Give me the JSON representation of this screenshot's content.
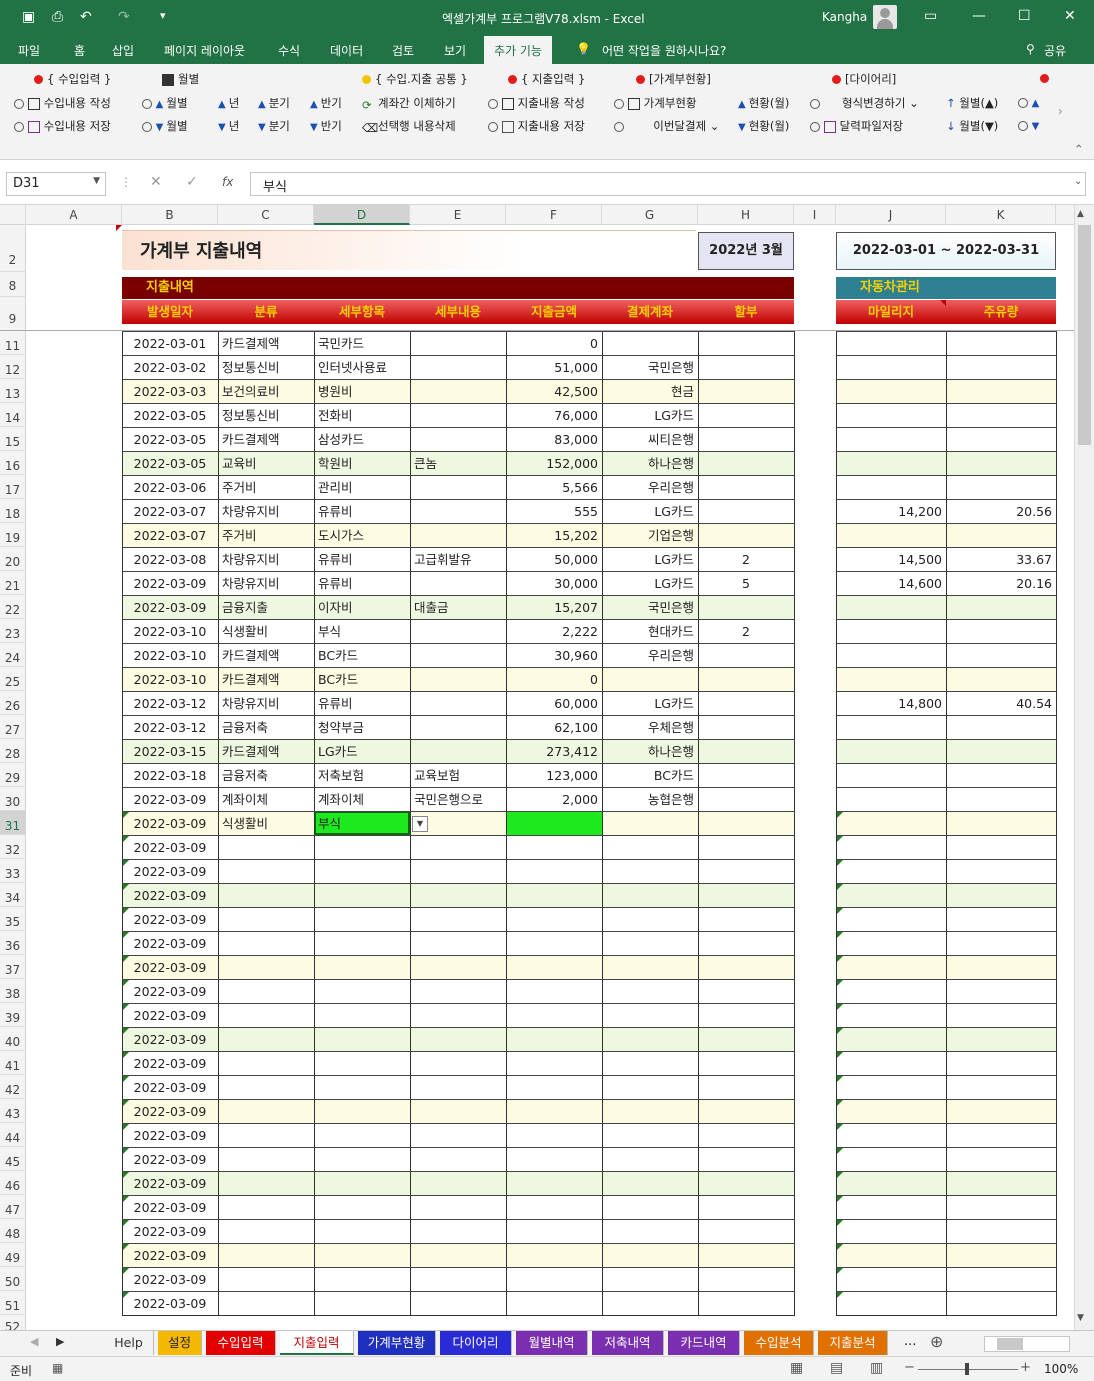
{
  "titlebar": {
    "title": "엑셀가계부 프로그램V78.xlsm  -  Excel",
    "user": "Kangha"
  },
  "ribbon_tabs": [
    "파일",
    "홈",
    "삽입",
    "페이지 레이아웃",
    "수식",
    "데이터",
    "검토",
    "보기",
    "추가 기능"
  ],
  "tell_me": "어떤 작업을 원하시나요?",
  "share": "공유",
  "ribbon": {
    "income_hdr": "{ 수입입력 }",
    "income_write": "수입내용 작성",
    "income_save": "수입내용 저장",
    "monthly_hdr": "월별",
    "m_up": "월별",
    "m_dn": "월별",
    "y_up": "년",
    "y_dn": "년",
    "q_up": "분기",
    "q_dn": "분기",
    "h_up": "반기",
    "h_dn": "반기",
    "common_hdr": "{ 수입.지출 공통 }",
    "transfer": "계좌간 이체하기",
    "delete_row": "선택행 내용삭제",
    "expense_hdr": "{ 지출입력 }",
    "expense_write": "지출내용 작성",
    "expense_save": "지출내용 저장",
    "status_hdr": "[가계부현황]",
    "status_btn": "가계부현황",
    "this_month": "이번달결제",
    "cur_up": "현황(월)",
    "cur_dn": "현황(월)",
    "diary_hdr": "[다이어리]",
    "format_change": "형식변경하기",
    "cal_save": "달력파일저장",
    "dm_up": "월별(▲)",
    "dm_dn": "월별(▼)"
  },
  "namebox": "D31",
  "formula": "부식",
  "columns": [
    "A",
    "B",
    "C",
    "D",
    "E",
    "F",
    "G",
    "H",
    "I",
    "J",
    "K"
  ],
  "sheet": {
    "title": "가계부 지출내역",
    "month": "2022년 3월",
    "period": "2022-03-01 ~ 2022-03-31",
    "section": "지출내역",
    "car_section": "자동차관리",
    "headers": [
      "발생일자",
      "분류",
      "세부항목",
      "세부내용",
      "지출금액",
      "결제계좌",
      "할부"
    ],
    "car_headers": [
      "마일리지",
      "주유량"
    ]
  },
  "rows": [
    {
      "n": "11",
      "date": "2022-03-01",
      "cat": "카드결제액",
      "item": "국민카드",
      "detail": "",
      "amt": "0",
      "acct": "",
      "inst": "",
      "mile": "",
      "fuel": ""
    },
    {
      "n": "12",
      "date": "2022-03-02",
      "cat": "정보통신비",
      "item": "인터넷사용료",
      "detail": "",
      "amt": "51,000",
      "acct": "국민은행",
      "inst": "",
      "mile": "",
      "fuel": ""
    },
    {
      "n": "13",
      "date": "2022-03-03",
      "cat": "보건의료비",
      "item": "병원비",
      "detail": "",
      "amt": "42,500",
      "acct": "현금",
      "inst": "",
      "mile": "",
      "fuel": ""
    },
    {
      "n": "14",
      "date": "2022-03-05",
      "cat": "정보통신비",
      "item": "전화비",
      "detail": "",
      "amt": "76,000",
      "acct": "LG카드",
      "inst": "",
      "mile": "",
      "fuel": ""
    },
    {
      "n": "15",
      "date": "2022-03-05",
      "cat": "카드결제액",
      "item": "삼성카드",
      "detail": "",
      "amt": "83,000",
      "acct": "씨티은행",
      "inst": "",
      "mile": "",
      "fuel": ""
    },
    {
      "n": "16",
      "date": "2022-03-05",
      "cat": "교육비",
      "item": "학원비",
      "detail": "큰놈",
      "amt": "152,000",
      "acct": "하나은행",
      "inst": "",
      "mile": "",
      "fuel": ""
    },
    {
      "n": "17",
      "date": "2022-03-06",
      "cat": "주거비",
      "item": "관리비",
      "detail": "",
      "amt": "5,566",
      "acct": "우리은행",
      "inst": "",
      "mile": "",
      "fuel": ""
    },
    {
      "n": "18",
      "date": "2022-03-07",
      "cat": "차량유지비",
      "item": "유류비",
      "detail": "",
      "amt": "555",
      "acct": "LG카드",
      "inst": "",
      "mile": "14,200",
      "fuel": "20.56"
    },
    {
      "n": "19",
      "date": "2022-03-07",
      "cat": "주거비",
      "item": "도시가스",
      "detail": "",
      "amt": "15,202",
      "acct": "기업은행",
      "inst": "",
      "mile": "",
      "fuel": ""
    },
    {
      "n": "20",
      "date": "2022-03-08",
      "cat": "차량유지비",
      "item": "유류비",
      "detail": "고급휘발유",
      "amt": "50,000",
      "acct": "LG카드",
      "inst": "2",
      "mile": "14,500",
      "fuel": "33.67"
    },
    {
      "n": "21",
      "date": "2022-03-09",
      "cat": "차량유지비",
      "item": "유류비",
      "detail": "",
      "amt": "30,000",
      "acct": "LG카드",
      "inst": "5",
      "mile": "14,600",
      "fuel": "20.16"
    },
    {
      "n": "22",
      "date": "2022-03-09",
      "cat": "금융지출",
      "item": "이자비",
      "detail": "대출금",
      "amt": "15,207",
      "acct": "국민은행",
      "inst": "",
      "mile": "",
      "fuel": ""
    },
    {
      "n": "23",
      "date": "2022-03-10",
      "cat": "식생활비",
      "item": "부식",
      "detail": "",
      "amt": "2,222",
      "acct": "현대카드",
      "inst": "2",
      "mile": "",
      "fuel": ""
    },
    {
      "n": "24",
      "date": "2022-03-10",
      "cat": "카드결제액",
      "item": "BC카드",
      "detail": "",
      "amt": "30,960",
      "acct": "우리은행",
      "inst": "",
      "mile": "",
      "fuel": ""
    },
    {
      "n": "25",
      "date": "2022-03-10",
      "cat": "카드결제액",
      "item": "BC카드",
      "detail": "",
      "amt": "0",
      "acct": "",
      "inst": "",
      "mile": "",
      "fuel": ""
    },
    {
      "n": "26",
      "date": "2022-03-12",
      "cat": "차량유지비",
      "item": "유류비",
      "detail": "",
      "amt": "60,000",
      "acct": "LG카드",
      "inst": "",
      "mile": "14,800",
      "fuel": "40.54"
    },
    {
      "n": "27",
      "date": "2022-03-12",
      "cat": "금융저축",
      "item": "청약부금",
      "detail": "",
      "amt": "62,100",
      "acct": "우체은행",
      "inst": "",
      "mile": "",
      "fuel": ""
    },
    {
      "n": "28",
      "date": "2022-03-15",
      "cat": "카드결제액",
      "item": "LG카드",
      "detail": "",
      "amt": "273,412",
      "acct": "하나은행",
      "inst": "",
      "mile": "",
      "fuel": ""
    },
    {
      "n": "29",
      "date": "2022-03-18",
      "cat": "금융저축",
      "item": "저축보험",
      "detail": "교육보험",
      "amt": "123,000",
      "acct": "BC카드",
      "inst": "",
      "mile": "",
      "fuel": ""
    },
    {
      "n": "30",
      "date": "2022-03-09",
      "cat": "계좌이체",
      "item": "계좌이체",
      "detail": "국민은행으로",
      "amt": "2,000",
      "acct": "농협은행",
      "inst": "",
      "mile": "",
      "fuel": ""
    },
    {
      "n": "31",
      "date": "2022-03-09",
      "cat": "식생활비",
      "item": "부식",
      "detail": "",
      "amt": "",
      "acct": "",
      "inst": "",
      "mile": "",
      "fuel": ""
    },
    {
      "n": "32",
      "date": "2022-03-09",
      "cat": "",
      "item": "",
      "detail": "",
      "amt": "",
      "acct": "",
      "inst": "",
      "mile": "",
      "fuel": ""
    },
    {
      "n": "33",
      "date": "2022-03-09",
      "cat": "",
      "item": "",
      "detail": "",
      "amt": "",
      "acct": "",
      "inst": "",
      "mile": "",
      "fuel": ""
    },
    {
      "n": "34",
      "date": "2022-03-09",
      "cat": "",
      "item": "",
      "detail": "",
      "amt": "",
      "acct": "",
      "inst": "",
      "mile": "",
      "fuel": ""
    },
    {
      "n": "35",
      "date": "2022-03-09",
      "cat": "",
      "item": "",
      "detail": "",
      "amt": "",
      "acct": "",
      "inst": "",
      "mile": "",
      "fuel": ""
    },
    {
      "n": "36",
      "date": "2022-03-09",
      "cat": "",
      "item": "",
      "detail": "",
      "amt": "",
      "acct": "",
      "inst": "",
      "mile": "",
      "fuel": ""
    },
    {
      "n": "37",
      "date": "2022-03-09",
      "cat": "",
      "item": "",
      "detail": "",
      "amt": "",
      "acct": "",
      "inst": "",
      "mile": "",
      "fuel": ""
    },
    {
      "n": "38",
      "date": "2022-03-09",
      "cat": "",
      "item": "",
      "detail": "",
      "amt": "",
      "acct": "",
      "inst": "",
      "mile": "",
      "fuel": ""
    },
    {
      "n": "39",
      "date": "2022-03-09",
      "cat": "",
      "item": "",
      "detail": "",
      "amt": "",
      "acct": "",
      "inst": "",
      "mile": "",
      "fuel": ""
    },
    {
      "n": "40",
      "date": "2022-03-09",
      "cat": "",
      "item": "",
      "detail": "",
      "amt": "",
      "acct": "",
      "inst": "",
      "mile": "",
      "fuel": ""
    },
    {
      "n": "41",
      "date": "2022-03-09",
      "cat": "",
      "item": "",
      "detail": "",
      "amt": "",
      "acct": "",
      "inst": "",
      "mile": "",
      "fuel": ""
    },
    {
      "n": "42",
      "date": "2022-03-09",
      "cat": "",
      "item": "",
      "detail": "",
      "amt": "",
      "acct": "",
      "inst": "",
      "mile": "",
      "fuel": ""
    },
    {
      "n": "43",
      "date": "2022-03-09",
      "cat": "",
      "item": "",
      "detail": "",
      "amt": "",
      "acct": "",
      "inst": "",
      "mile": "",
      "fuel": ""
    },
    {
      "n": "44",
      "date": "2022-03-09",
      "cat": "",
      "item": "",
      "detail": "",
      "amt": "",
      "acct": "",
      "inst": "",
      "mile": "",
      "fuel": ""
    },
    {
      "n": "45",
      "date": "2022-03-09",
      "cat": "",
      "item": "",
      "detail": "",
      "amt": "",
      "acct": "",
      "inst": "",
      "mile": "",
      "fuel": ""
    },
    {
      "n": "46",
      "date": "2022-03-09",
      "cat": "",
      "item": "",
      "detail": "",
      "amt": "",
      "acct": "",
      "inst": "",
      "mile": "",
      "fuel": ""
    },
    {
      "n": "47",
      "date": "2022-03-09",
      "cat": "",
      "item": "",
      "detail": "",
      "amt": "",
      "acct": "",
      "inst": "",
      "mile": "",
      "fuel": ""
    },
    {
      "n": "48",
      "date": "2022-03-09",
      "cat": "",
      "item": "",
      "detail": "",
      "amt": "",
      "acct": "",
      "inst": "",
      "mile": "",
      "fuel": ""
    },
    {
      "n": "49",
      "date": "2022-03-09",
      "cat": "",
      "item": "",
      "detail": "",
      "amt": "",
      "acct": "",
      "inst": "",
      "mile": "",
      "fuel": ""
    },
    {
      "n": "50",
      "date": "2022-03-09",
      "cat": "",
      "item": "",
      "detail": "",
      "amt": "",
      "acct": "",
      "inst": "",
      "mile": "",
      "fuel": ""
    },
    {
      "n": "51",
      "date": "2022-03-09",
      "cat": "",
      "item": "",
      "detail": "",
      "amt": "",
      "acct": "",
      "inst": "",
      "mile": "",
      "fuel": ""
    }
  ],
  "top_rows": [
    "2",
    "8",
    "9"
  ],
  "last_row": "52",
  "sheet_tabs": [
    {
      "label": "Help",
      "bg": "#f3f3f3",
      "fg": "#333"
    },
    {
      "label": "설정",
      "bg": "#f5b800",
      "fg": "#222"
    },
    {
      "label": "수입입력",
      "bg": "#e30000",
      "fg": "#fff"
    },
    {
      "label": "지출입력",
      "bg": "#ffffff",
      "fg": "#c00000"
    },
    {
      "label": "가계부현황",
      "bg": "#1f2fbf",
      "fg": "#fff"
    },
    {
      "label": "다이어리",
      "bg": "#2b2bd6",
      "fg": "#fff"
    },
    {
      "label": "월별내역",
      "bg": "#7a2fb0",
      "fg": "#fff"
    },
    {
      "label": "저축내역",
      "bg": "#7a2fb0",
      "fg": "#fff"
    },
    {
      "label": "카드내역",
      "bg": "#7a2fb0",
      "fg": "#fff"
    },
    {
      "label": "수입분석",
      "bg": "#e07000",
      "fg": "#fff"
    },
    {
      "label": "지출분석",
      "bg": "#e07000",
      "fg": "#fff"
    }
  ],
  "status": {
    "ready": "준비",
    "zoom": "100%"
  }
}
